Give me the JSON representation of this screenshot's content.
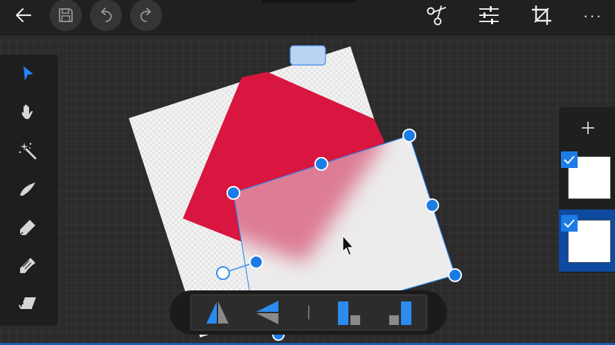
{
  "topbar": {
    "back": {
      "icon": "back-arrow-icon"
    },
    "save": {
      "icon": "save-disk-icon"
    },
    "undo": {
      "icon": "undo-icon"
    },
    "redo": {
      "icon": "redo-icon"
    },
    "cut": {
      "icon": "scissors-icon"
    },
    "adjust": {
      "icon": "sliders-icon"
    },
    "crop": {
      "icon": "crop-icon"
    },
    "more": {
      "icon": "more-icon",
      "label": "···"
    }
  },
  "tools": [
    {
      "name": "select",
      "icon": "arrow-select-icon",
      "active": true
    },
    {
      "name": "pan",
      "icon": "hand-icon"
    },
    {
      "name": "magic-wand",
      "icon": "magic-wand-icon"
    },
    {
      "name": "brush",
      "icon": "brush-icon"
    },
    {
      "name": "marker",
      "icon": "marker-icon"
    },
    {
      "name": "pencil",
      "icon": "pencil-icon"
    },
    {
      "name": "eraser",
      "icon": "eraser-icon"
    }
  ],
  "layers": {
    "add_icon": "plus-icon",
    "items": [
      {
        "checked": true,
        "selected": false
      },
      {
        "checked": true,
        "selected": true
      }
    ]
  },
  "align_bar": {
    "buttons": [
      {
        "icon": "flip-horizontal-icon"
      },
      {
        "icon": "flip-vertical-icon"
      },
      {
        "icon": "divider-icon"
      },
      {
        "icon": "align-bottom-left-icon"
      },
      {
        "icon": "align-bottom-right-icon"
      }
    ]
  },
  "colors": {
    "accent": "#1c7ce6",
    "shape_red": "#d91640",
    "toolbar_bg": "#1e1e1e",
    "canvas_bg": "#2b2b2b"
  }
}
